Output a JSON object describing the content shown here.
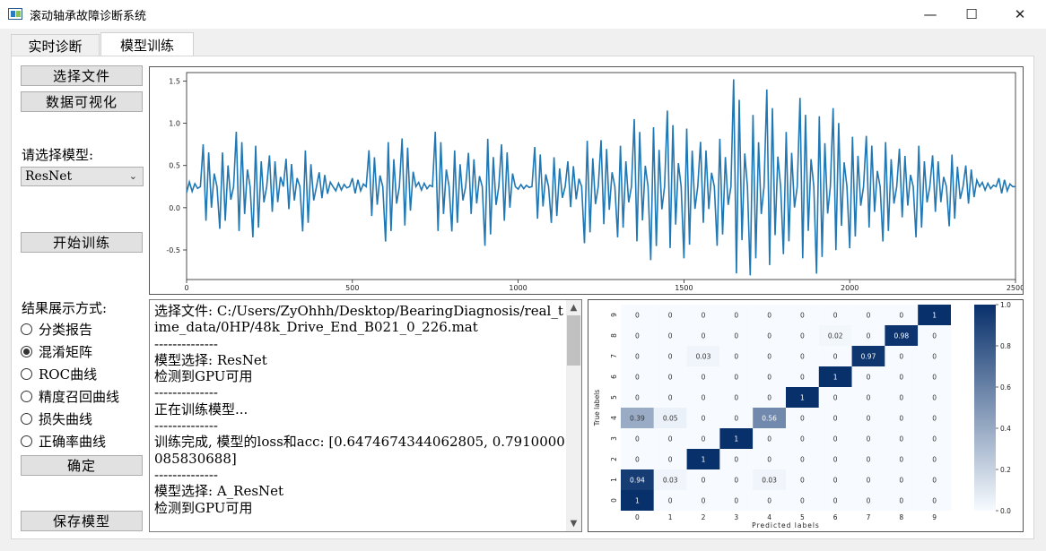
{
  "window": {
    "title": "滚动轴承故障诊断系统",
    "minimize": "—",
    "maximize": "☐",
    "close": "✕"
  },
  "tabs": [
    {
      "label": "实时诊断",
      "active": false
    },
    {
      "label": "模型训练",
      "active": true
    }
  ],
  "sidebar": {
    "select_file": "选择文件",
    "visualize": "数据可视化",
    "model_label": "请选择模型:",
    "model_selected": "ResNet",
    "train": "开始训练",
    "display_label": "结果展示方式:",
    "options": [
      {
        "label": "分类报告",
        "checked": false
      },
      {
        "label": "混淆矩阵",
        "checked": true
      },
      {
        "label": "ROC曲线",
        "checked": false
      },
      {
        "label": "精度召回曲线",
        "checked": false
      },
      {
        "label": "损失曲线",
        "checked": false
      },
      {
        "label": "正确率曲线",
        "checked": false
      }
    ],
    "confirm": "确定",
    "save_model": "保存模型"
  },
  "log": {
    "lines": [
      "选择文件: C:/Users/ZyOhhh/Desktop/BearingDiagnosis/real_time_data/0HP/48k_Drive_End_B021_0_226.mat",
      "--------------",
      "模型选择: ResNet",
      "检测到GPU可用",
      "--------------",
      "正在训练模型...",
      "--------------",
      "训练完成, 模型的loss和acc: [0.6474674344062805, 0.7910000085830688]",
      "--------------",
      "模型选择: A_ResNet",
      "检测到GPU可用"
    ]
  },
  "chart_data": [
    {
      "type": "line",
      "xlim": [
        0,
        2500
      ],
      "ylim": [
        -0.85,
        1.6
      ],
      "x_ticks": [
        "0",
        "500",
        "1000",
        "1500",
        "2000",
        "2500"
      ],
      "y_ticks": [
        "-0.5",
        "0.0",
        "0.5",
        "1.0",
        "1.5"
      ],
      "series": [
        {
          "color": "#1f77b4",
          "x": [
            0,
            50,
            100,
            150,
            200,
            250,
            300,
            350,
            400,
            450,
            500,
            550,
            600,
            650,
            700,
            750,
            800,
            850,
            900,
            950,
            1000,
            1050,
            1100,
            1150,
            1200,
            1250,
            1300,
            1350,
            1400,
            1450,
            1500,
            1550,
            1600,
            1650,
            1700,
            1750,
            1800,
            1850,
            1900,
            1950,
            2000,
            2050,
            2100,
            2150,
            2200,
            2250,
            2300,
            2350,
            2400,
            2450,
            2500
          ],
          "values": [
            0.18,
            0.75,
            -0.25,
            0.9,
            -0.35,
            0.62,
            0.58,
            -0.28,
            0.42,
            0.2,
            0.35,
            0.68,
            -0.4,
            0.82,
            0.3,
            0.9,
            -0.28,
            0.65,
            -0.45,
            0.75,
            0.22,
            0.72,
            -0.18,
            0.55,
            -0.42,
            0.8,
            -0.35,
            1.05,
            -0.62,
            1.15,
            -0.6,
            0.78,
            -0.45,
            1.52,
            -0.8,
            1.4,
            -0.55,
            1.3,
            -0.78,
            1.18,
            -0.48,
            0.85,
            -0.4,
            0.7,
            -0.35,
            0.62,
            -0.22,
            0.5,
            0.3,
            0.35,
            0.25
          ]
        }
      ]
    },
    {
      "type": "heatmap",
      "xlabel": "Predicted labels",
      "ylabel": "True labels",
      "categories": [
        "0",
        "1",
        "2",
        "3",
        "4",
        "5",
        "6",
        "7",
        "8",
        "9"
      ],
      "colorbar_ticks": [
        "0.0",
        "0.2",
        "0.4",
        "0.6",
        "0.8",
        "1.0"
      ],
      "matrix": [
        [
          1,
          0,
          0,
          0,
          0,
          0,
          0,
          0,
          0,
          0
        ],
        [
          0.94,
          0.03,
          0,
          0,
          0.03,
          0,
          0,
          0,
          0,
          0
        ],
        [
          0,
          0,
          1,
          0,
          0,
          0,
          0,
          0,
          0,
          0
        ],
        [
          0,
          0,
          0,
          1,
          0,
          0,
          0,
          0,
          0,
          0
        ],
        [
          0.39,
          0.05,
          0,
          0,
          0.56,
          0,
          0,
          0,
          0,
          0
        ],
        [
          0,
          0,
          0,
          0,
          0,
          1,
          0,
          0,
          0,
          0
        ],
        [
          0,
          0,
          0,
          0,
          0,
          0,
          1,
          0,
          0,
          0
        ],
        [
          0,
          0,
          0.03,
          0,
          0,
          0,
          0,
          0.97,
          0,
          0
        ],
        [
          0,
          0,
          0,
          0,
          0,
          0,
          0.02,
          0,
          0.98,
          0
        ],
        [
          0,
          0,
          0,
          0,
          0,
          0,
          0,
          0,
          0,
          1
        ]
      ]
    }
  ]
}
